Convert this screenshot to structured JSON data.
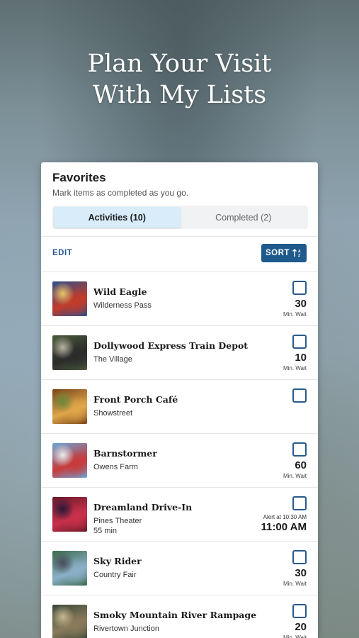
{
  "hero": {
    "line1": "Plan Your Visit",
    "line2": "With My Lists"
  },
  "card": {
    "title": "Favorites",
    "subtitle": "Mark items as completed as you go.",
    "tabs": [
      {
        "label": "Activities (10)",
        "active": true
      },
      {
        "label": "Completed (2)",
        "active": false
      }
    ],
    "edit_label": "EDIT",
    "sort_label": "SORT",
    "sort_icon": "sort-az-icon"
  },
  "items": [
    {
      "name": "Wild Eagle",
      "area": "Wilderness Pass",
      "wait": "30",
      "wait_label": "Min. Wait",
      "thumb": "roller-coaster",
      "thumb_colors": [
        "#2c4f8a",
        "#c23b2a",
        "#e8c46a"
      ]
    },
    {
      "name": "Dollywood Express Train Depot",
      "area": "The Village",
      "wait": "10",
      "wait_label": "Min. Wait",
      "thumb": "steam-train",
      "thumb_colors": [
        "#4a5a3a",
        "#2b2b2b",
        "#b8b0a0"
      ]
    },
    {
      "name": "Front Porch Café",
      "area": "Showstreet",
      "thumb": "food-plate",
      "thumb_colors": [
        "#7a4418",
        "#e0a64a",
        "#6a8a3a"
      ]
    },
    {
      "name": "Barnstormer",
      "area": "Owens Farm",
      "wait": "60",
      "wait_label": "Min. Wait",
      "thumb": "swing-ride",
      "thumb_colors": [
        "#6aa6d8",
        "#c83a3a",
        "#eaeaea"
      ]
    },
    {
      "name": "Dreamland Drive-In",
      "area": "Pines Theater",
      "extra": "55 min",
      "alert_label": "Alert at 10:30 AM",
      "alert_time": "11:00 AM",
      "thumb": "stage-show",
      "thumb_colors": [
        "#6a1a2a",
        "#c8304a",
        "#2a1a3a"
      ]
    },
    {
      "name": "Sky Rider",
      "area": "Country Fair",
      "wait": "30",
      "wait_label": "Min. Wait",
      "thumb": "sky-ride",
      "thumb_colors": [
        "#3a6a4a",
        "#8ab0c8",
        "#4a4a5a"
      ]
    },
    {
      "name": "Smoky Mountain River Rampage",
      "area": "Rivertown Junction",
      "wait": "20",
      "wait_label": "Min. Wait",
      "thumb": "river-raft",
      "thumb_colors": [
        "#3a4a3a",
        "#8a7a5a",
        "#c8b890"
      ]
    }
  ]
}
